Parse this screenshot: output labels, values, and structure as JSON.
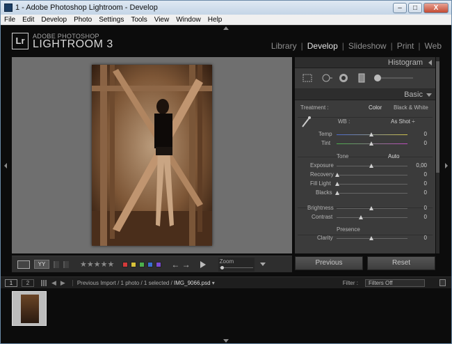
{
  "window": {
    "title": "1 - Adobe Photoshop Lightroom - Develop",
    "minimize": "–",
    "maximize": "□",
    "close": "X"
  },
  "menu": [
    "File",
    "Edit",
    "Develop",
    "Photo",
    "Settings",
    "Tools",
    "View",
    "Window",
    "Help"
  ],
  "brand": {
    "badge": "Lr",
    "line1": "ADOBE PHOTOSHOP",
    "line2": "LIGHTROOM 3"
  },
  "modules": [
    {
      "label": "Library",
      "active": false
    },
    {
      "label": "Develop",
      "active": true
    },
    {
      "label": "Slideshow",
      "active": false
    },
    {
      "label": "Print",
      "active": false
    },
    {
      "label": "Web",
      "active": false
    }
  ],
  "toolbar": {
    "view_label": "YY",
    "stars": "★★★★★",
    "arrows": "← →",
    "zoom_label": "Zoom"
  },
  "colors": {
    "labels": [
      "#d23a3a",
      "#d8c23a",
      "#4cb04c",
      "#3a6fd2",
      "#7a4ad2"
    ]
  },
  "panel": {
    "histogram": "Histogram",
    "basic": "Basic",
    "treatment_label": "Treatment :",
    "treatment_color": "Color",
    "treatment_bw": "Black & White",
    "wb_label": "WB :",
    "wb_value": "As Shot ÷",
    "temp_label": "Temp",
    "temp_value": "0",
    "tint_label": "Tint",
    "tint_value": "0",
    "tone_label": "Tone",
    "tone_auto": "Auto",
    "exposure_label": "Exposure",
    "exposure_value": "0,00",
    "recovery_label": "Recovery",
    "recovery_value": "0",
    "filllight_label": "Fill Light",
    "filllight_value": "0",
    "blacks_label": "Blacks",
    "blacks_value": "0",
    "brightness_label": "Brightness",
    "brightness_value": "0",
    "contrast_label": "Contrast",
    "contrast_value": "0",
    "presence_label": "Presence",
    "clarity_label": "Clarity",
    "clarity_value": "0"
  },
  "buttons": {
    "previous": "Previous",
    "reset": "Reset"
  },
  "filmstrip": {
    "page1": "1",
    "page2": "2",
    "breadcrumb": "Previous Import / 1 photo / 1 selected /",
    "filename": "IMG_9066.psd",
    "filter_label": "Filter :",
    "filter_value": "Filters Off"
  }
}
